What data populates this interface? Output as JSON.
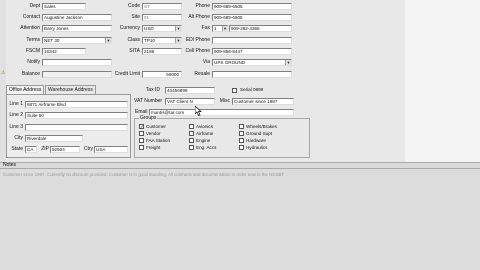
{
  "top": {
    "dept_label": "Dept",
    "dept_value": "Sales",
    "contact_label": "Contact",
    "contact_value": "Augustine Jackson",
    "attention_label": "Attention",
    "attention_value": "Barry Jones",
    "terms_label": "Terms",
    "terms_value": "NET 30",
    "fscm_label": "FSCM",
    "fscm_value": "16342",
    "notify_label": "Notify",
    "notify_value": "",
    "balance_label": "Balance",
    "balance_value": "",
    "code_label": "Code",
    "code_value": "ST",
    "site_label": "Site",
    "site_value": "01",
    "currency_label": "Currency",
    "currency_value": "USD",
    "class_label": "Class",
    "class_value": "TP10",
    "sita_label": "SITA",
    "sita_value": "2188",
    "credit_limit_label": "Credit Limit",
    "credit_limit_value": "50000",
    "phone_label": "Phone",
    "phone_value": "909-689-6505",
    "alt_phone_label": "Alt Phone",
    "alt_phone_value": "909-689-6505",
    "fax_label": "Fax",
    "fax_code": "1",
    "fax_value": "909-262-4356",
    "edi_phone_label": "EDI Phone",
    "edi_phone_value": "",
    "cell_phone_label": "Cell Phone",
    "cell_phone_value": "909-856-8447",
    "via_label": "Via",
    "via_value": "UPS GROUND",
    "resale_label": "Resale",
    "resale_value": ""
  },
  "tabs": {
    "office": "Office Address",
    "warehouse": "Warehouse Address"
  },
  "address": {
    "line1_label": "Line 1",
    "line1_value": "6871 Airframe Blvd",
    "line2_label": "Line 2",
    "line2_value": "Suite 50",
    "line3_label": "Line 3",
    "line3_value": "",
    "city_label": "City",
    "city_value": "Riverdale",
    "state_label": "State",
    "state_value": "CA",
    "zip_label": "ZIP",
    "zip_value": "92504",
    "ctry_label": "Ctry",
    "ctry_value": "USA"
  },
  "right": {
    "taxid_label": "Tax ID",
    "taxid_value": "43456899",
    "serial_label": "Serial 0999",
    "vat_label": "VAT Number",
    "vat_value": "VAT Client N",
    "misc_label": "Misc",
    "misc_value": "Customer since 1987",
    "email_label": "Email",
    "email_value": "mantis@tar.com"
  },
  "groups": {
    "legend": "Groups",
    "items": [
      {
        "label": "Customer",
        "checked": "✓"
      },
      {
        "label": "Vendor",
        "checked": ""
      },
      {
        "label": "FAA Station",
        "checked": ""
      },
      {
        "label": "Freight",
        "checked": ""
      },
      {
        "label": "Avionics",
        "checked": ""
      },
      {
        "label": "Airframe",
        "checked": ""
      },
      {
        "label": "Engine",
        "checked": ""
      },
      {
        "label": "Eng. Accs",
        "checked": ""
      },
      {
        "label": "Wheels/Brakes",
        "checked": ""
      },
      {
        "label": "Ground Supt",
        "checked": ""
      },
      {
        "label": "Hardware",
        "checked": ""
      },
      {
        "label": "Hydraulics",
        "checked": ""
      }
    ]
  },
  "notes": {
    "label": "Notes",
    "text": "Customer since 1987. Currently no discount provided. Customer is in good standing. All contracts and documentation in order now in the NGSBT"
  }
}
